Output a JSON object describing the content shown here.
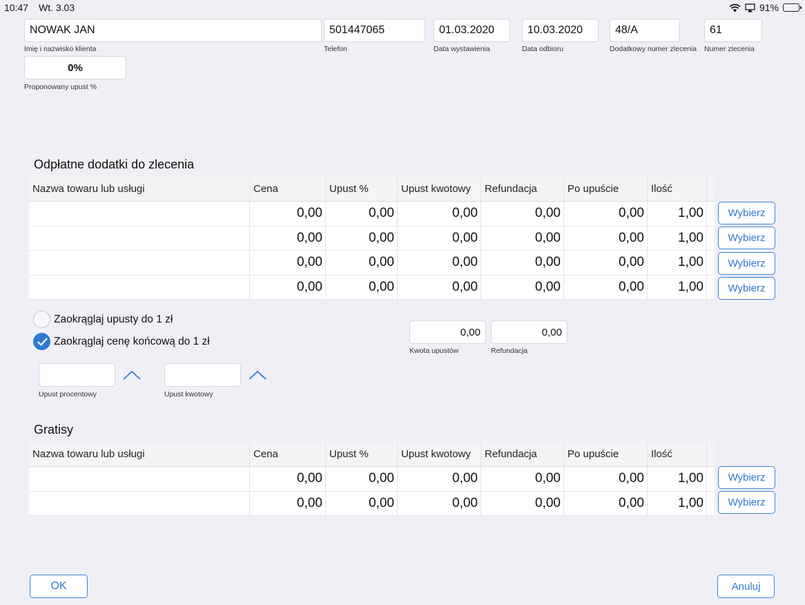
{
  "status": {
    "time": "10:47",
    "date": "Wt. 3.03",
    "battery": "91%",
    "battery_level": 0.91
  },
  "header": {
    "client_name": {
      "value": "NOWAK JAN",
      "label": "Imię i nazwisko klienta"
    },
    "phone": {
      "value": "501447065",
      "label": "Telefon"
    },
    "issue_date": {
      "value": "01.03.2020",
      "label": "Data wystawienia"
    },
    "pickup_date": {
      "value": "10.03.2020",
      "label": "Data odbioru"
    },
    "extra_order_no": {
      "value": "48/A",
      "label": "Dodatkowy numer zlecenia"
    },
    "order_no": {
      "value": "61",
      "label": "Numer zlecenia"
    },
    "discount_pct": {
      "value": "0%",
      "label": "Proponowany upust %"
    }
  },
  "columns": [
    "Nazwa towaru lub usługi",
    "Cena",
    "Upust %",
    "Upust kwotowy",
    "Refundacja",
    "Po upuście",
    "Ilość"
  ],
  "paid": {
    "title": "Odpłatne dodatki do zlecenia",
    "rows": [
      [
        "",
        "0,00",
        "0,00",
        "0,00",
        "0,00",
        "0,00",
        "1,00"
      ],
      [
        "",
        "0,00",
        "0,00",
        "0,00",
        "0,00",
        "0,00",
        "1,00"
      ],
      [
        "",
        "0,00",
        "0,00",
        "0,00",
        "0,00",
        "0,00",
        "1,00"
      ],
      [
        "",
        "0,00",
        "0,00",
        "0,00",
        "0,00",
        "0,00",
        "1,00"
      ]
    ]
  },
  "free": {
    "title": "Gratisy",
    "rows": [
      [
        "",
        "0,00",
        "0,00",
        "0,00",
        "0,00",
        "0,00",
        "1,00"
      ],
      [
        "",
        "0,00",
        "0,00",
        "0,00",
        "0,00",
        "0,00",
        "1,00"
      ]
    ]
  },
  "select_label": "Wybierz",
  "options": {
    "round_discounts": {
      "label": "Zaokrąglaj upusty do 1 zł",
      "checked": false
    },
    "round_final": {
      "label": "Zaokrąglaj cenę końcową do 1 zł",
      "checked": true
    }
  },
  "totals": {
    "discount_amount": {
      "value": "0,00",
      "label": "Kwota upustów"
    },
    "refund": {
      "value": "0,00",
      "label": "Refundacja"
    }
  },
  "discount_inputs": {
    "percent": {
      "value": "",
      "label": "Upust procentowy"
    },
    "amount": {
      "value": "",
      "label": "Upust kwotowy"
    }
  },
  "actions": {
    "ok": "OK",
    "cancel": "Anuluj"
  },
  "colors": {
    "accent": "#2f7ad0",
    "background": "#f0eff5"
  }
}
